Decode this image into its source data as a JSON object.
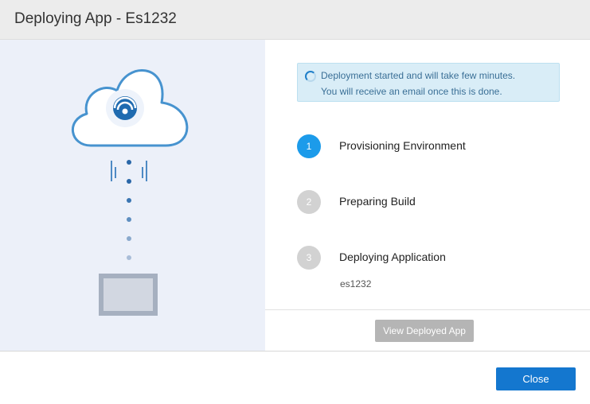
{
  "dialog": {
    "title": "Deploying App - Es1232"
  },
  "info": {
    "line1": "Deployment started and will take few minutes.",
    "line2": "You will receive an email once this is done."
  },
  "steps": [
    {
      "number": "1",
      "label": "Provisioning Environment",
      "status": "active"
    },
    {
      "number": "2",
      "label": "Preparing Build",
      "status": "pending"
    },
    {
      "number": "3",
      "label": "Deploying Application",
      "status": "pending",
      "sublabel": "es1232"
    }
  ],
  "actions": {
    "view_label": "View Deployed App",
    "close_label": "Close"
  },
  "colors": {
    "accent": "#1c9bea",
    "primary_button": "#1477cf",
    "disabled_button": "#b5b5b5",
    "info_background": "#d9edf7",
    "illustration_background": "#ecf0f9"
  },
  "icons": {
    "illustration": "cloud-deploy-to-server-illustration",
    "spinner": "loading-spinner-icon"
  }
}
